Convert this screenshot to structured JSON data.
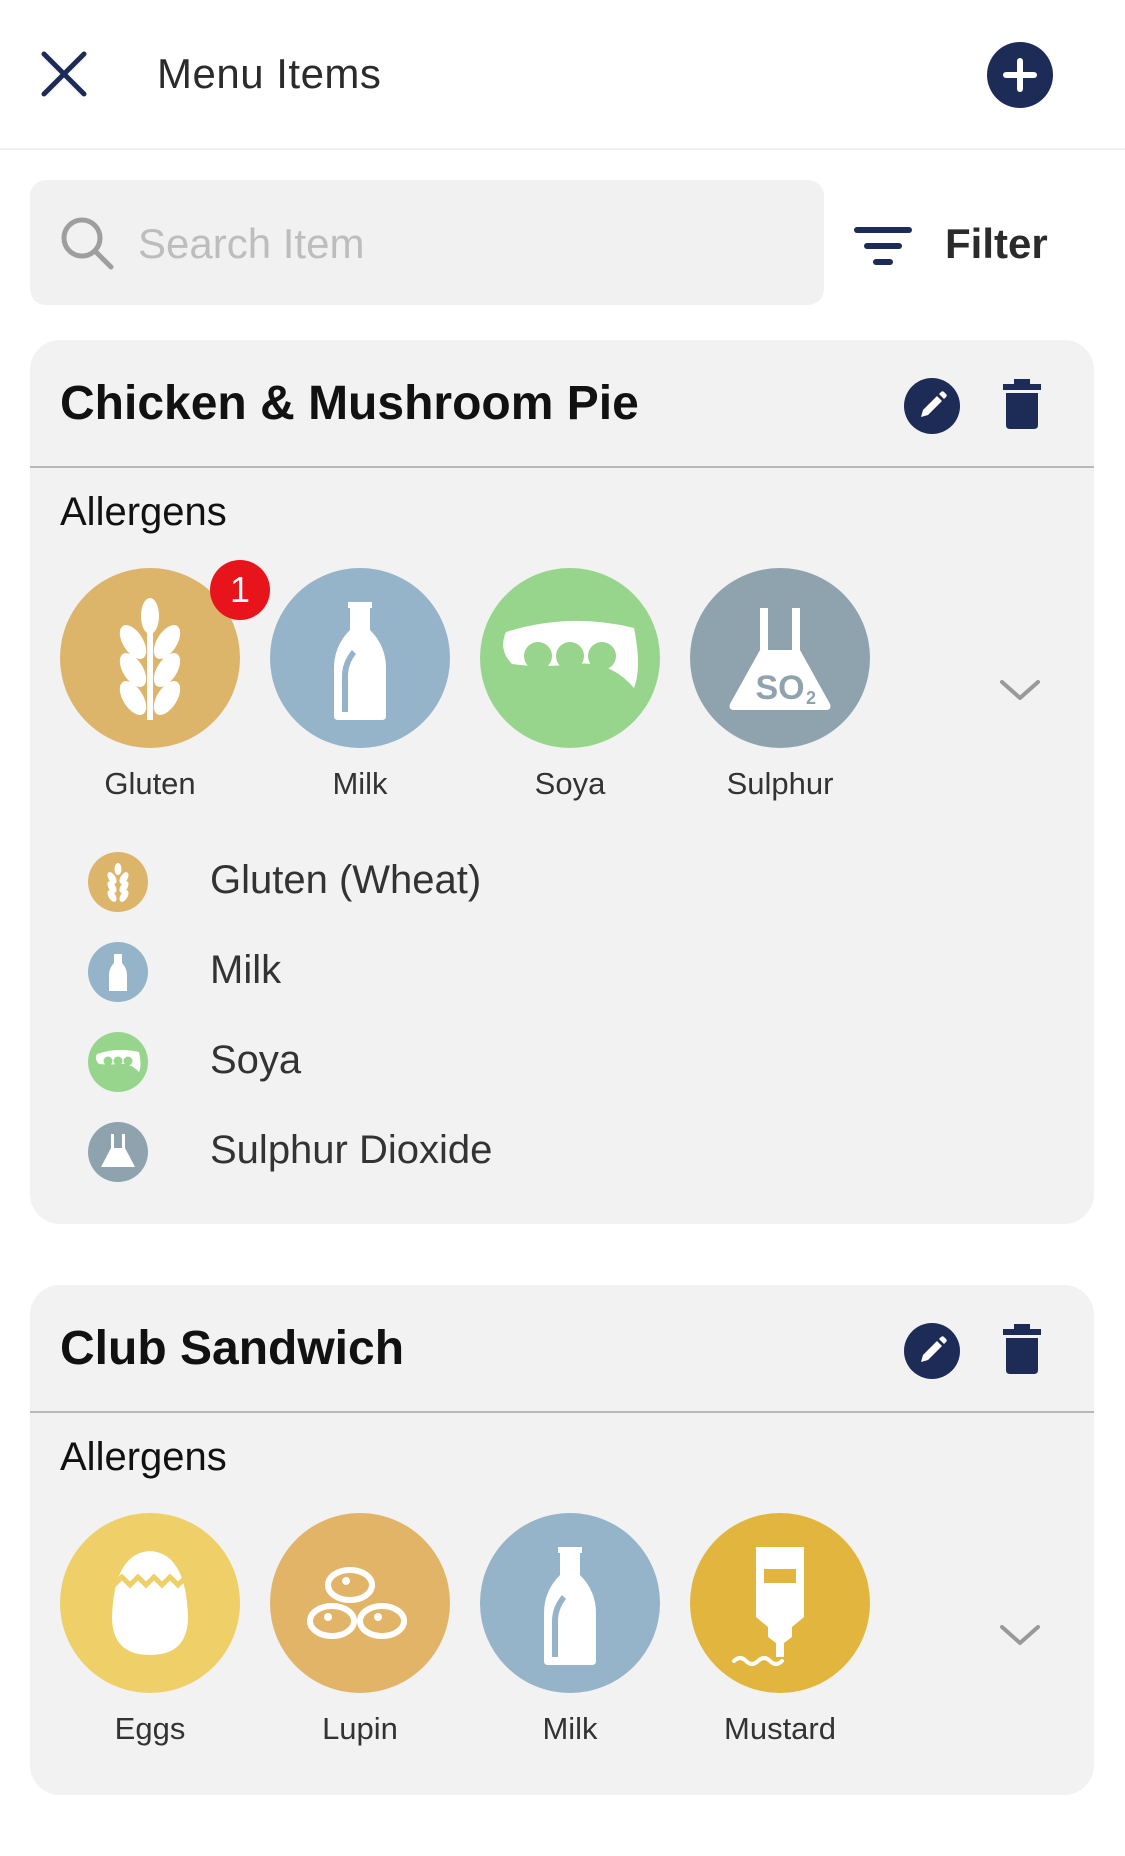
{
  "header": {
    "title": "Menu Items",
    "close_icon": "close-icon",
    "add_icon": "plus-circle-icon"
  },
  "search": {
    "placeholder": "Search Item",
    "value": ""
  },
  "filter": {
    "label": "Filter",
    "icon": "filter-lines-icon"
  },
  "colors": {
    "navy": "#1d2b57",
    "card_bg": "#f2f2f2",
    "badge": "#e8141c",
    "gluten": "#dcb46a",
    "milk": "#95b3c9",
    "soya": "#98d58c",
    "sulphur": "#8fa3ae",
    "eggs": "#eecf68",
    "lupin": "#e2b468",
    "mustard": "#e2b63e"
  },
  "menu_items": [
    {
      "name": "Chicken & Mushroom Pie",
      "allergens_label": "Allergens",
      "allergens": [
        {
          "name": "Gluten",
          "icon": "wheat-icon",
          "badge": "1"
        },
        {
          "name": "Milk",
          "icon": "milk-bottle-icon"
        },
        {
          "name": "Soya",
          "icon": "soya-pod-icon"
        },
        {
          "name": "Sulphur",
          "icon": "so2-flask-icon"
        }
      ],
      "details": [
        {
          "label": "Gluten (Wheat)",
          "icon": "wheat-icon"
        },
        {
          "label": "Milk",
          "icon": "milk-bottle-icon"
        },
        {
          "label": "Soya",
          "icon": "soya-pod-icon"
        },
        {
          "label": "Sulphur Dioxide",
          "icon": "so2-flask-icon"
        }
      ]
    },
    {
      "name": "Club Sandwich",
      "allergens_label": "Allergens",
      "allergens": [
        {
          "name": "Eggs",
          "icon": "egg-icon"
        },
        {
          "name": "Lupin",
          "icon": "lupin-beans-icon"
        },
        {
          "name": "Milk",
          "icon": "milk-bottle-icon"
        },
        {
          "name": "Mustard",
          "icon": "mustard-bottle-icon"
        }
      ]
    }
  ]
}
